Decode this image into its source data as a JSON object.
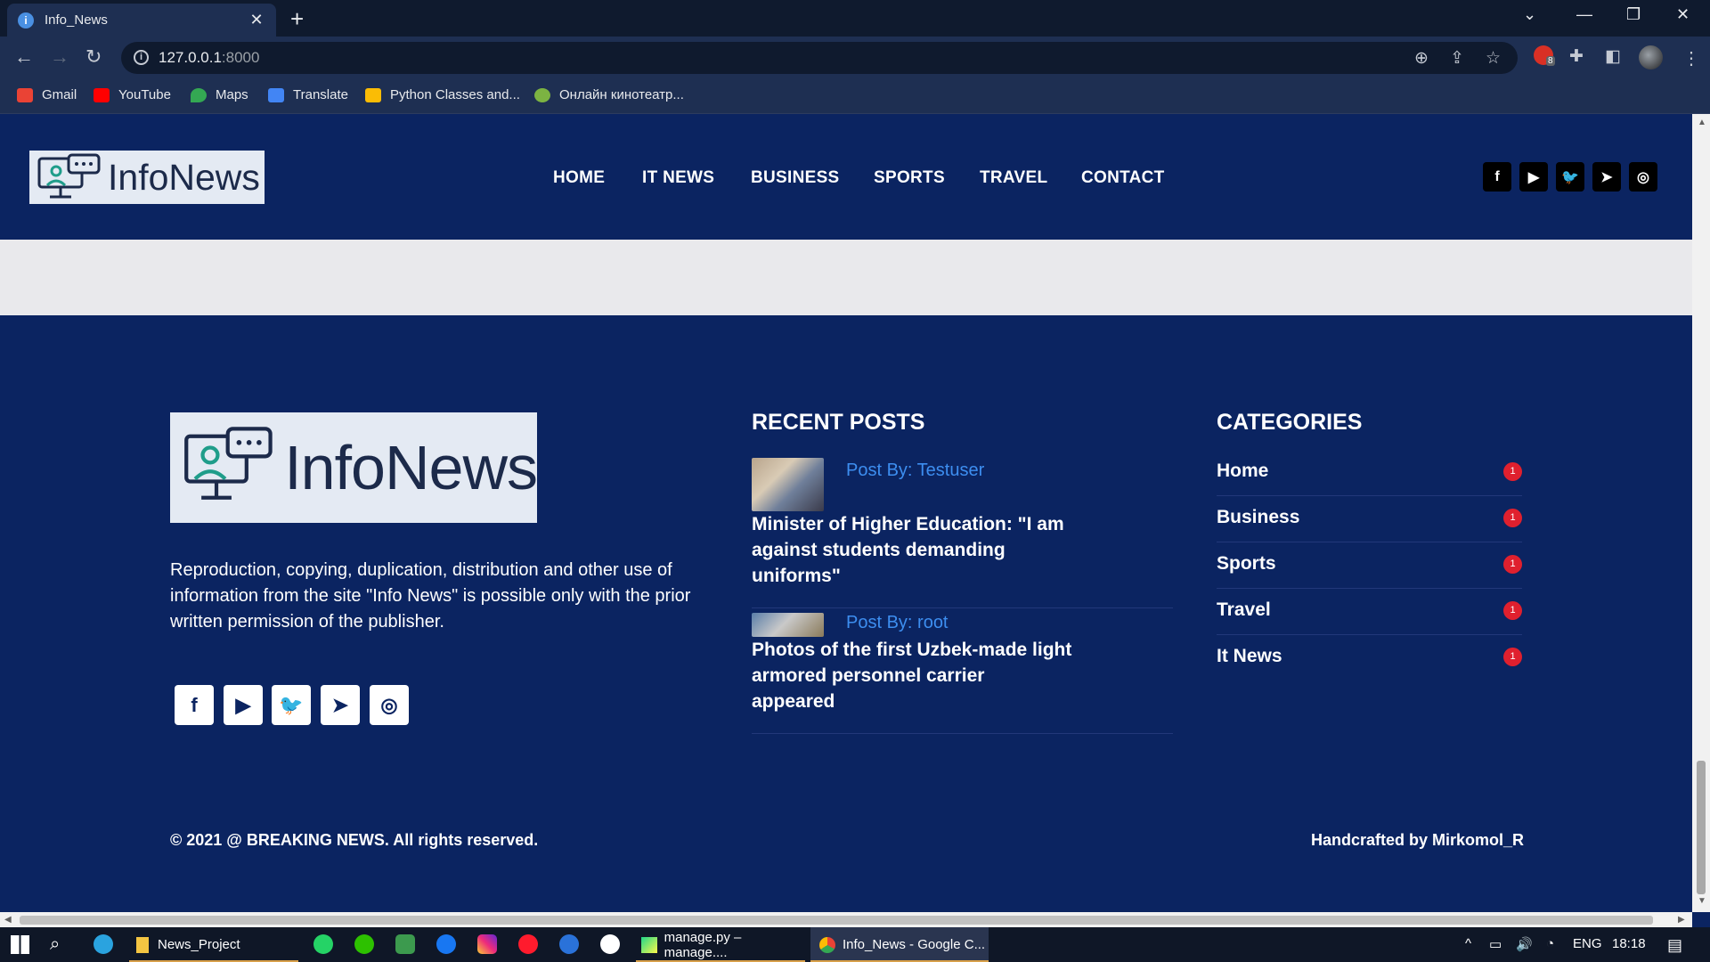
{
  "browser": {
    "tab_title": "Info_News",
    "tab_favicon": "i",
    "new_tab": "+",
    "url_host": "127.0.0.1",
    "url_port": ":8000",
    "ext_badge": "8",
    "bookmarks": [
      {
        "label": "Gmail",
        "icon": "gmail-icon",
        "color": "#ea4335"
      },
      {
        "label": "YouTube",
        "icon": "youtube-icon",
        "color": "#ff0000"
      },
      {
        "label": "Maps",
        "icon": "maps-icon",
        "color": "#34a853"
      },
      {
        "label": "Translate",
        "icon": "translate-icon",
        "color": "#4285f4"
      },
      {
        "label": "Python Classes and...",
        "icon": "python-icon",
        "color": "#fbbc05"
      },
      {
        "label": "Онлайн кинотеатр...",
        "icon": "cinema-icon",
        "color": "#7cb342"
      }
    ]
  },
  "site": {
    "logo_text": "InfoNews",
    "nav": [
      "HOME",
      "IT NEWS",
      "BUSINESS",
      "SPORTS",
      "TRAVEL",
      "CONTACT"
    ],
    "social": [
      "facebook-icon",
      "youtube-icon",
      "twitter-icon",
      "telegram-icon",
      "instagram-icon"
    ]
  },
  "footer": {
    "logo_text": "InfoNews",
    "description": "Reproduction, copying, duplication, distribution and other use of information from the site \"Info News\" is possible only with the prior written permission of the publisher.",
    "recent_posts_title": "RECENT POSTS",
    "recent_posts": [
      {
        "author": "Post By: Testuser",
        "title": "Minister of Higher Education: \"I am against students demanding uniforms\""
      },
      {
        "author": "Post By: root",
        "title": "Photos of the first Uzbek-made light armored personnel carrier appeared"
      }
    ],
    "categories_title": "CATEGORIES",
    "categories": [
      {
        "name": "Home",
        "count": "1"
      },
      {
        "name": "Business",
        "count": "1"
      },
      {
        "name": "Sports",
        "count": "1"
      },
      {
        "name": "Travel",
        "count": "1"
      },
      {
        "name": "It News",
        "count": "1"
      }
    ],
    "copyright": "© 2021 @ BREAKING NEWS. All rights reserved.",
    "credit": "Handcrafted by Mirkomol_R"
  },
  "taskbar": {
    "apps": [
      {
        "label": "News_Project"
      },
      {
        "label": "manage.py – manage...."
      },
      {
        "label": "Info_News - Google C..."
      }
    ],
    "lang": "ENG",
    "time": "18:18"
  },
  "colors": {
    "accent": "#3d8ef0",
    "brand_bg": "#0b2461",
    "badge": "#e0202e"
  }
}
